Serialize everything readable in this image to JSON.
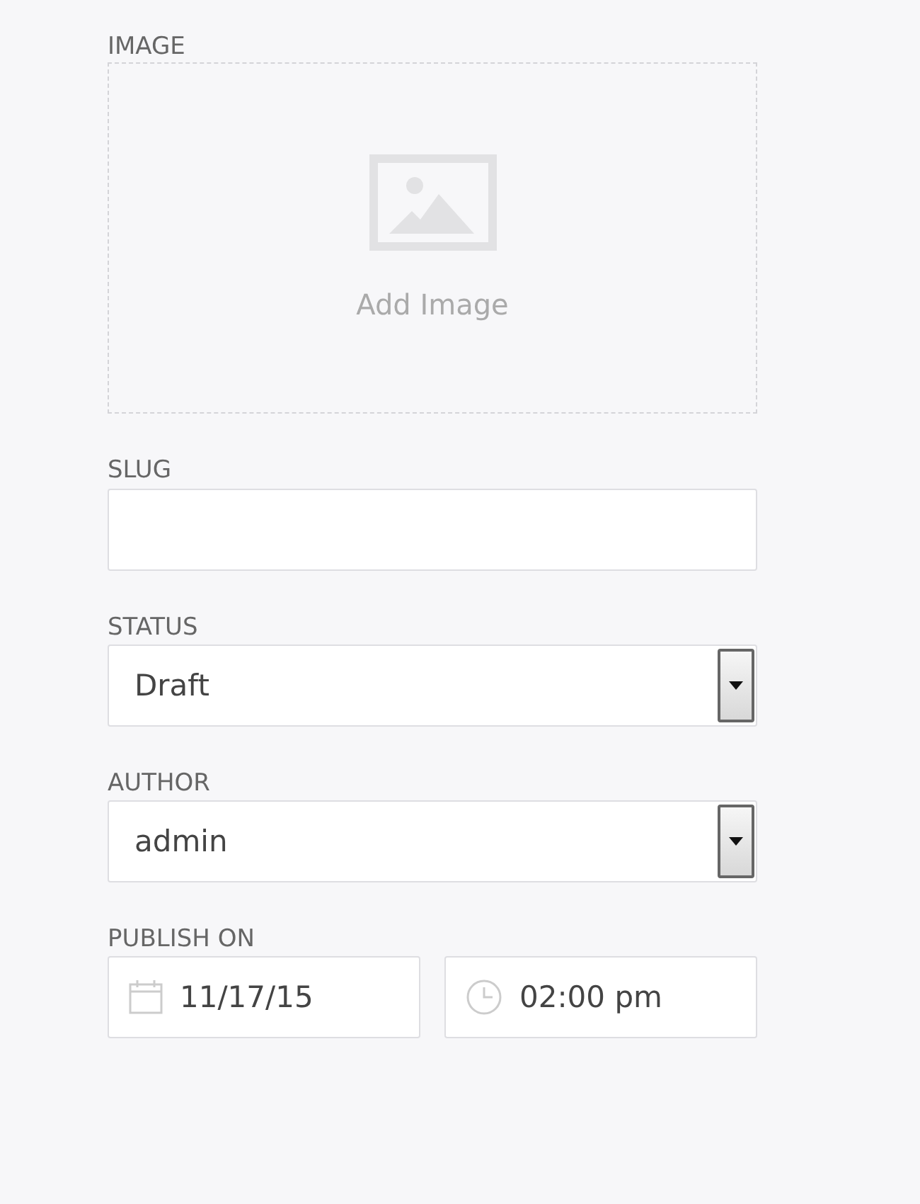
{
  "fields": [
    {
      "kind": "upload",
      "label": "IMAGE",
      "prompt": "Add Image"
    },
    {
      "kind": "text",
      "label": "SLUG"
    },
    {
      "kind": "select",
      "label": "STATUS",
      "value": "Draft"
    },
    {
      "kind": "select",
      "label": "AUTHOR",
      "value": "admin"
    },
    {
      "kind": "datetime",
      "label": "PUBLISH ON",
      "date": "11/17/15",
      "time": "02:00 pm"
    }
  ]
}
